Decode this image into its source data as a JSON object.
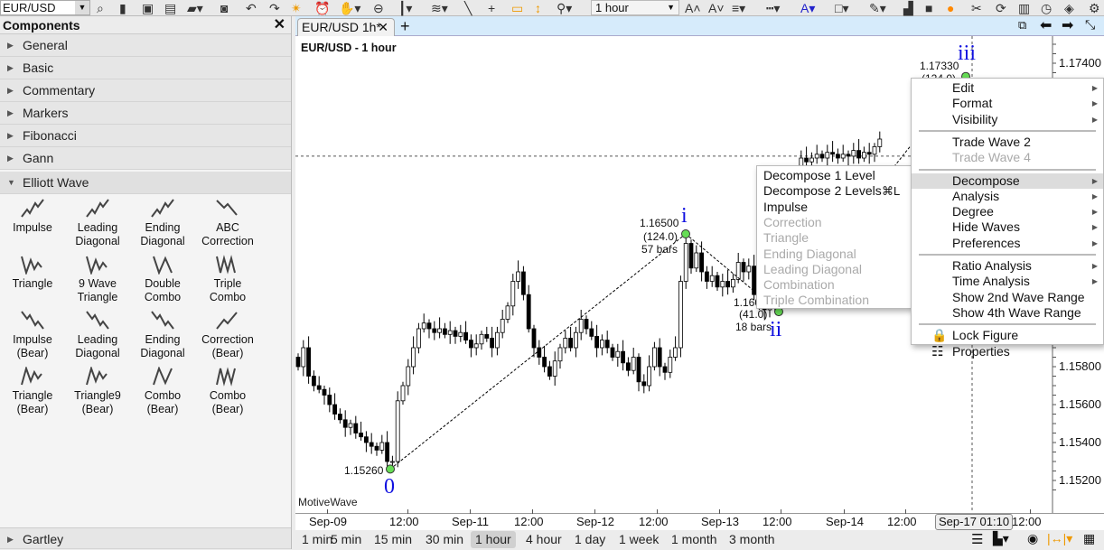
{
  "toolbar": {
    "symbol": "EUR/USD",
    "timeframe": "1 hour",
    "icons": [
      "search-icon",
      "new-icon",
      "save-icon",
      "save-as-icon",
      "open-icon",
      "camera-icon",
      "undo-icon",
      "redo-icon",
      "magic-icon",
      "alarm-icon",
      "hand-icon",
      "zoom-out-icon",
      "candle-icon",
      "fib-icon",
      "line-icon",
      "crosshair-icon",
      "lock-icon",
      "fit-icon",
      "link-icon",
      "font-larger-icon",
      "font-smaller-icon",
      "line-weight-icon",
      "line-style-icon",
      "text-color-icon",
      "fill-color-icon",
      "highlight-icon",
      "lock-levels-icon",
      "shadow-icon",
      "theme-icon",
      "tools-icon",
      "refresh-icon",
      "columns-icon",
      "clock-icon",
      "tag-icon",
      "gear-icon"
    ]
  },
  "panel": {
    "title": "Components",
    "sections": [
      "General",
      "Basic",
      "Commentary",
      "Markers",
      "Fibonacci",
      "Gann"
    ],
    "expanded": "Elliott Wave",
    "components": [
      "Impulse",
      "Leading Diagonal",
      "Ending Diagonal",
      "ABC Correction",
      "Triangle",
      "9 Wave Triangle",
      "Double Combo",
      "Triple Combo",
      "Impulse (Bear)",
      "Leading Diagonal",
      "Ending Diagonal",
      "Correction (Bear)",
      "Triangle (Bear)",
      "Triangle9 (Bear)",
      "Combo (Bear)",
      "Combo (Bear)"
    ],
    "footer": "Gartley"
  },
  "tab": {
    "label": "EUR/USD 1h*",
    "add": "+"
  },
  "chart": {
    "title": "EUR/USD - 1 hour",
    "watermark": "MotiveWave",
    "price_labels": [
      "1.17400",
      "1.15800",
      "1.15600",
      "1.15400",
      "1.15200"
    ],
    "time_labels": [
      "Sep-09",
      "12:00",
      "Sep-11",
      "12:00",
      "Sep-12",
      "12:00",
      "Sep-13",
      "12:00",
      "Sep-14",
      "12:00",
      "12:00"
    ],
    "crosshair_time": "Sep-17 01:10",
    "waves": [
      {
        "label": "0",
        "price": "1.15260"
      },
      {
        "label": "i",
        "price": "1.16500",
        "points": "(124.0)",
        "bars": "57 bars"
      },
      {
        "label": "ii",
        "price": "1.160",
        "points": "(41.0)",
        "bars": "18 bars"
      },
      {
        "label": "iii",
        "price": "1.17330",
        "points": "(124.0)"
      }
    ]
  },
  "chart_data": {
    "type": "candlestick",
    "y_range": [
      1.151,
      1.175
    ],
    "closes": [
      1.158,
      1.159,
      1.1575,
      1.157,
      1.1568,
      1.1565,
      1.156,
      1.1555,
      1.1552,
      1.1548,
      1.155,
      1.1545,
      1.1543,
      1.154,
      1.1538,
      1.1536,
      1.154,
      1.153,
      1.153,
      1.1562,
      1.157,
      1.158,
      1.159,
      1.16,
      1.1603,
      1.16,
      1.1598,
      1.16,
      1.1597,
      1.1599,
      1.1596,
      1.1598,
      1.1594,
      1.159,
      1.1592,
      1.1597,
      1.1595,
      1.159,
      1.1598,
      1.1605,
      1.1612,
      1.1625,
      1.163,
      1.1618,
      1.16,
      1.159,
      1.1585,
      1.158,
      1.1575,
      1.1583,
      1.159,
      1.1595,
      1.159,
      1.1598,
      1.1605,
      1.16,
      1.1596,
      1.159,
      1.1594,
      1.159,
      1.1585,
      1.1588,
      1.1582,
      1.1578,
      1.1585,
      1.1572,
      1.157,
      1.158,
      1.159,
      1.158,
      1.1577,
      1.1585,
      1.159,
      1.1625,
      1.1645,
      1.1632,
      1.164,
      1.163,
      1.1625,
      1.1628,
      1.1622,
      1.1625,
      1.1622,
      1.1626,
      1.1635,
      1.163,
      1.1633,
      1.1618,
      1.1612,
      1.161,
      1.1615,
      1.1612,
      1.162,
      1.164,
      1.166,
      1.168,
      1.169,
      1.1688,
      1.169,
      1.1692,
      1.169,
      1.1693,
      1.1692,
      1.169,
      1.1692,
      1.1691,
      1.1694,
      1.169,
      1.1693,
      1.1692,
      1.1696,
      1.17
    ],
    "horizontal_line": 1.1691
  },
  "timeframes": [
    "1 min",
    "5 min",
    "15 min",
    "30 min",
    "1 hour",
    "4 hour",
    "1 day",
    "1 week",
    "1 month",
    "3 month"
  ],
  "selected_timeframe": "1 hour",
  "context_menu": [
    {
      "label": "Edit",
      "sub": true
    },
    {
      "label": "Format",
      "sub": true
    },
    {
      "label": "Visibility",
      "sub": true
    },
    {
      "sep": true
    },
    {
      "label": "Trade Wave 2"
    },
    {
      "label": "Trade Wave 4",
      "disabled": true
    },
    {
      "sep": true
    },
    {
      "label": "Decompose",
      "sub": true,
      "highlight": true
    },
    {
      "label": "Analysis",
      "sub": true
    },
    {
      "label": "Degree",
      "sub": true
    },
    {
      "label": "Hide Waves",
      "sub": true
    },
    {
      "label": "Preferences",
      "sub": true
    },
    {
      "sep": true
    },
    {
      "label": "Ratio Analysis",
      "sub": true
    },
    {
      "label": "Time Analysis",
      "sub": true
    },
    {
      "label": "Show 2nd Wave Range"
    },
    {
      "label": "Show 4th Wave Range"
    },
    {
      "sep": true
    },
    {
      "label": "Lock Figure",
      "icon": "lock-icon"
    },
    {
      "label": "Properties",
      "icon": "properties-icon"
    }
  ],
  "submenu": [
    {
      "label": "Decompose 1 Level"
    },
    {
      "label": "Decompose 2 Levels",
      "shortcut": "⌘L"
    },
    {
      "label": "Impulse"
    },
    {
      "label": "Correction",
      "disabled": true
    },
    {
      "label": "Triangle",
      "disabled": true
    },
    {
      "label": "Ending Diagonal",
      "disabled": true
    },
    {
      "label": "Leading Diagonal",
      "disabled": true
    },
    {
      "label": "Combination",
      "disabled": true
    },
    {
      "label": "Triple Combination",
      "disabled": true
    }
  ],
  "colors": {
    "wave_label": "#1010e0",
    "pivot": "#66dd55",
    "tab_bar": "#d6ebfb",
    "lock": "#f5a623"
  }
}
